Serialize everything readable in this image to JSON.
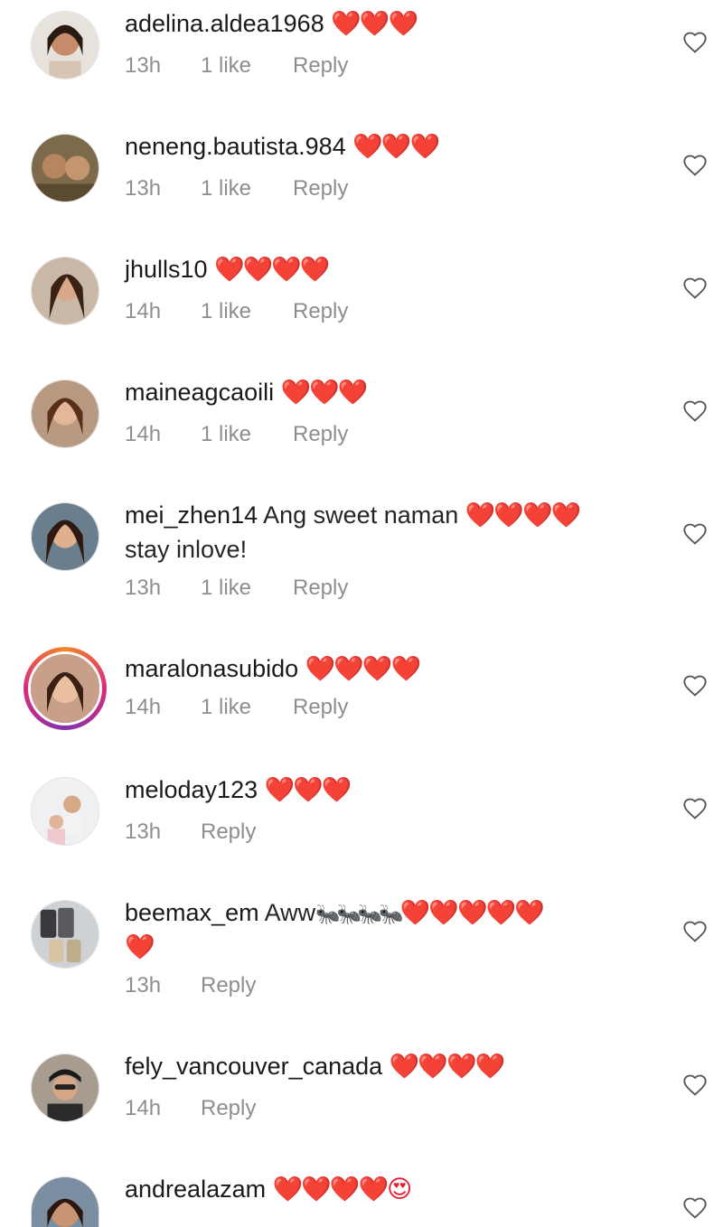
{
  "comments": [
    {
      "username": "adelina.aldea1968",
      "text": "",
      "emoji": "❤️❤️❤️",
      "time": "13h",
      "likes": "1 like",
      "reply": "Reply"
    },
    {
      "username": "neneng.bautista.984",
      "text": "",
      "emoji": "❤️❤️❤️",
      "time": "13h",
      "likes": "1 like",
      "reply": "Reply"
    },
    {
      "username": "jhulls10",
      "text": "",
      "emoji": "❤️❤️❤️❤️",
      "time": "14h",
      "likes": "1 like",
      "reply": "Reply"
    },
    {
      "username": "maineagcaoili",
      "text": "",
      "emoji": "❤️❤️❤️",
      "time": "14h",
      "likes": "1 like",
      "reply": "Reply"
    },
    {
      "username": "mei_zhen14",
      "text": "Ang sweet naman",
      "emoji": "❤️❤️❤️❤️",
      "text2": "stay inlove!",
      "time": "13h",
      "likes": "1 like",
      "reply": "Reply"
    },
    {
      "username": "maralonasubido",
      "text": "",
      "emoji": "❤️❤️❤️❤️",
      "time": "14h",
      "likes": "1 like",
      "reply": "Reply"
    },
    {
      "username": "meloday123",
      "text": "",
      "emoji": "❤️❤️❤️",
      "time": "13h",
      "reply": "Reply"
    },
    {
      "username": "beemax_em",
      "text": "Aww",
      "ants": "🐜🐜🐜🐜",
      "emoji": "❤️❤️❤️❤️❤️",
      "emoji2": "❤️",
      "time": "13h",
      "reply": "Reply"
    },
    {
      "username": "fely_vancouver_canada",
      "text": "",
      "emoji": "❤️❤️❤️❤️",
      "time": "14h",
      "reply": "Reply"
    },
    {
      "username": "andrealazam",
      "text": "",
      "emoji": "❤️❤️❤️❤️😍",
      "time": "",
      "reply": ""
    }
  ],
  "icons": {
    "like": "heart-outline-icon",
    "emoji_heart": "red-heart-emoji"
  },
  "colors": {
    "meta_text": "#8e8e8e",
    "username": "#1a1a1a",
    "heart": "#e8192c",
    "story_ring": "#dd2a7b"
  }
}
